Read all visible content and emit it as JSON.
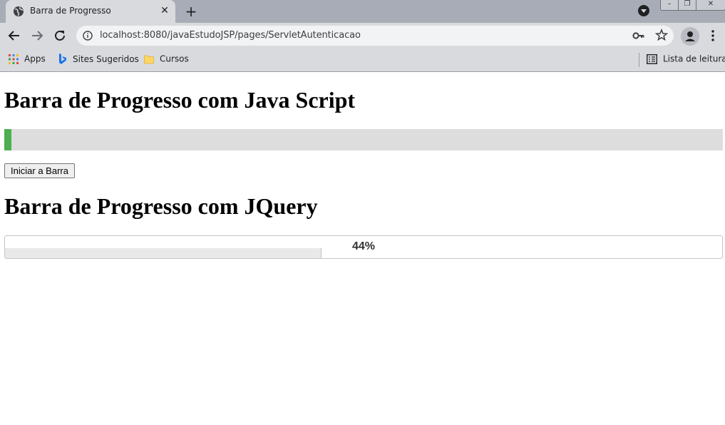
{
  "browser": {
    "tab_title": "Barra de Progresso",
    "url": "localhost:8080/javaEstudoJSP/pages/ServletAutenticacao",
    "bookmarks": [
      {
        "label": "Apps",
        "icon": "apps-grid-icon"
      },
      {
        "label": "Sites Sugeridos",
        "icon": "bing-icon"
      },
      {
        "label": "Cursos",
        "icon": "folder-icon"
      }
    ],
    "reading_list": "Lista de leitura"
  },
  "page": {
    "heading_js": "Barra de Progresso com Java Script",
    "js_progress_fraction": 0.01,
    "start_button": "Iniciar a Barra",
    "heading_jquery": "Barra de Progresso com JQuery",
    "jquery_progress_percent": 44,
    "jquery_progress_label": "44%"
  },
  "colors": {
    "js_bar_fill": "#4caf50",
    "js_bar_track": "#dddddd",
    "chrome_frame": "#a7acb6",
    "chrome_toolbar": "#d8dade"
  }
}
